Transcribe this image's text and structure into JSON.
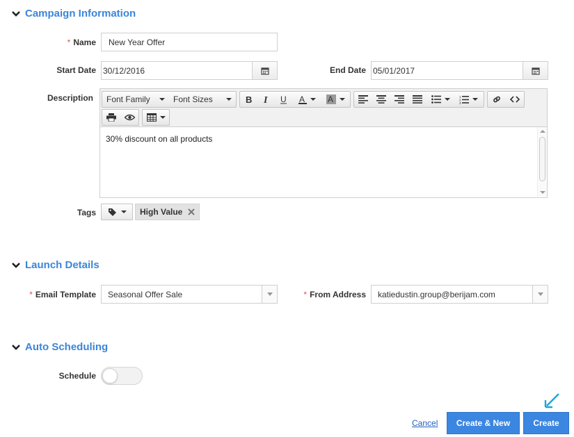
{
  "campaign_section": {
    "title": "Campaign Information",
    "name_label": "Name",
    "name_value": "New Year Offer",
    "start_date_label": "Start Date",
    "start_date_value": "30/12/2016",
    "end_date_label": "End Date",
    "end_date_value": "05/01/2017",
    "description_label": "Description",
    "editor": {
      "font_family": "Font Family",
      "font_sizes": "Font Sizes",
      "content": "30% discount on all products",
      "toolbar_icons": [
        "bold-icon",
        "italic-icon",
        "underline-icon",
        "text-color-icon",
        "highlight-icon",
        "align-left-icon",
        "align-center-icon",
        "align-right-icon",
        "align-justify-icon",
        "bullet-list-icon",
        "numbered-list-icon",
        "link-icon",
        "code-icon",
        "print-icon",
        "preview-icon",
        "table-icon"
      ]
    },
    "tags_label": "Tags",
    "tags": [
      "High Value"
    ]
  },
  "launch_section": {
    "title": "Launch Details",
    "email_template_label": "Email Template",
    "email_template_value": "Seasonal Offer Sale",
    "from_address_label": "From Address",
    "from_address_value": "katiedustin.group@berijam.com"
  },
  "scheduling_section": {
    "title": "Auto Scheduling",
    "schedule_label": "Schedule",
    "schedule_on": false
  },
  "actions": {
    "cancel": "Cancel",
    "create_new": "Create & New",
    "create": "Create"
  },
  "colors": {
    "accent": "#3b86d8",
    "primary_button": "#3b86e0",
    "required": "#d9534f",
    "pointer_arrow": "#1fa3d6"
  }
}
